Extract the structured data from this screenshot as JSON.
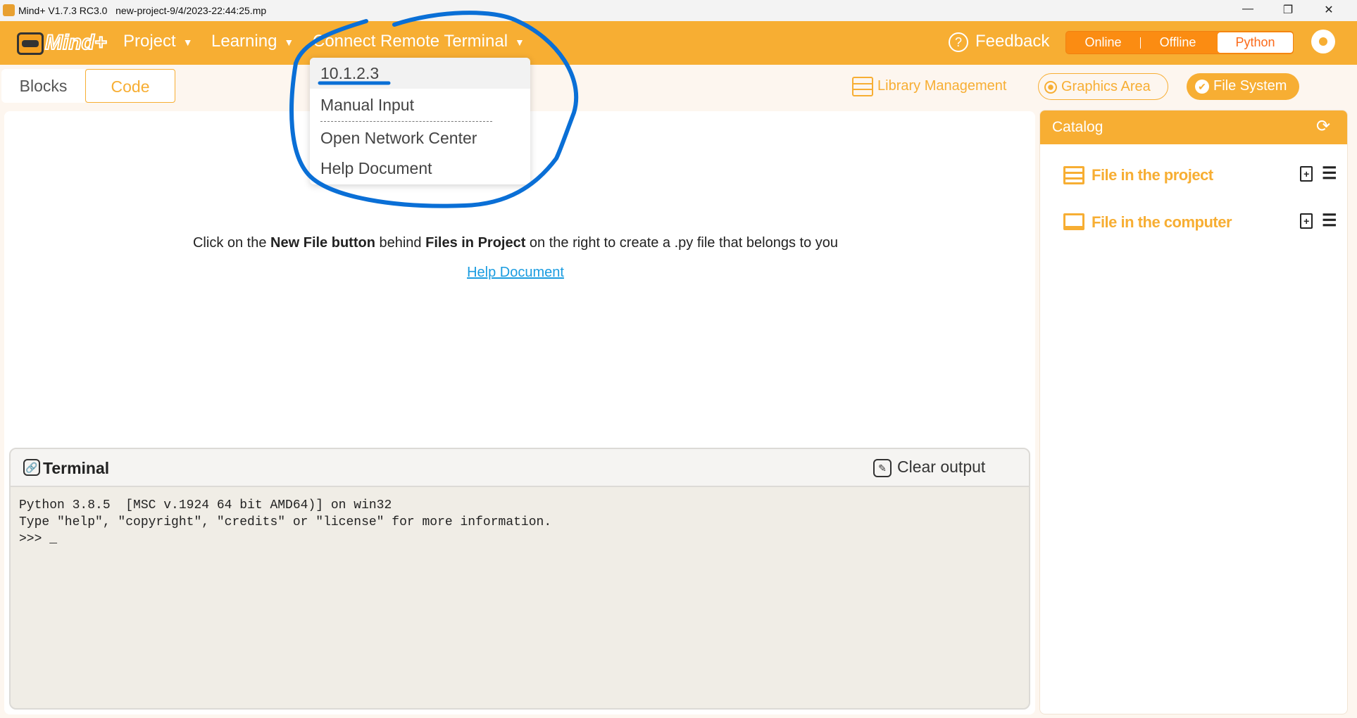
{
  "window": {
    "title": "Mind+ V1.7.3 RC3.0   new-project-9/4/2023-22:44:25.mp",
    "minimize": "—",
    "restore": "❐",
    "close": "✕"
  },
  "menubar": {
    "logo": "Mind+",
    "items": [
      {
        "label": "Project"
      },
      {
        "label": "Learning"
      },
      {
        "label": "Connect Remote Terminal"
      }
    ],
    "feedback": "Feedback",
    "modes": [
      {
        "label": "Online"
      },
      {
        "label": "Offline"
      },
      {
        "label": "Python",
        "selected": true
      }
    ],
    "accent": "#f7ae33"
  },
  "dropdown": {
    "items": [
      {
        "label": "10.1.2.3",
        "highlighted": true
      },
      {
        "label": "Manual Input"
      },
      {
        "label": "Open Network Center"
      },
      {
        "label": "Help Document"
      }
    ]
  },
  "tabs": [
    {
      "label": "Blocks"
    },
    {
      "label": "Code",
      "selected": true
    }
  ],
  "toolbar": {
    "library": "Library Management",
    "graphics": "Graphics Area",
    "filesystem": "File System"
  },
  "editor": {
    "hint_pre": "Click on the ",
    "hint_b1": "New File button",
    "hint_mid": " behind ",
    "hint_b2": "Files in Project",
    "hint_post": " on the right to create a .py file that belongs to you",
    "help_link": "Help Document"
  },
  "terminal": {
    "title": "Terminal",
    "clear": "Clear output",
    "lines": [
      "Python 3.8.5  [MSC v.1924 64 bit AMD64)] on win32",
      "Type \"help\", \"copyright\", \"credits\" or \"license\" for more information.",
      ">>> _"
    ]
  },
  "catalog": {
    "title": "Catalog",
    "items": [
      {
        "label": "File in the project"
      },
      {
        "label": "File in the computer"
      }
    ]
  },
  "annotation_color": "#0a6fd6"
}
